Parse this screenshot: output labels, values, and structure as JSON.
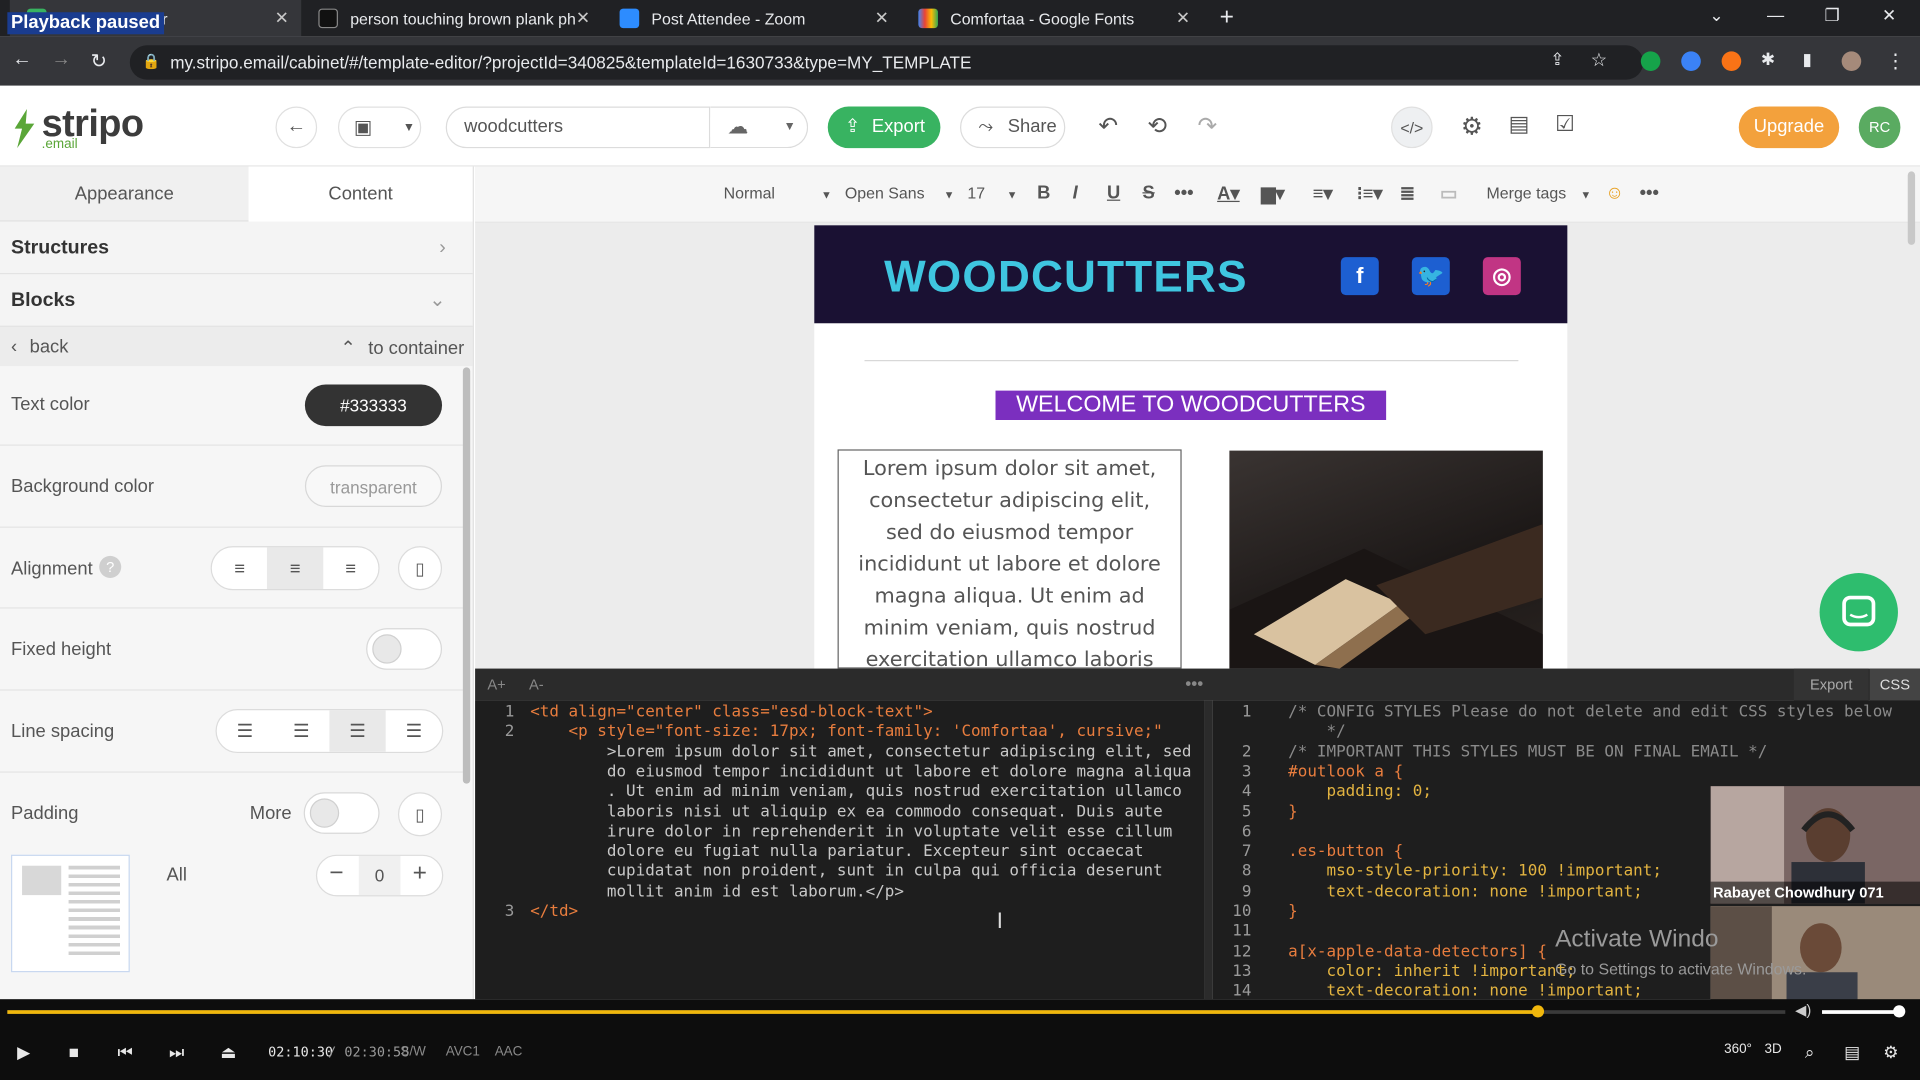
{
  "overlay": {
    "playback_status": "Playback paused"
  },
  "browser": {
    "tabs": [
      {
        "title": "Template editor",
        "active": true,
        "icon": "stripo-favicon"
      },
      {
        "title": "person touching brown plank ph",
        "active": false,
        "icon": "unsplash-favicon"
      },
      {
        "title": "Post Attendee - Zoom",
        "active": false,
        "icon": "zoom-favicon"
      },
      {
        "title": "Comfortaa - Google Fonts",
        "active": false,
        "icon": "google-fonts-favicon"
      }
    ],
    "url": "my.stripo.email/cabinet/#/template-editor/?projectId=340825&templateId=1630733&type=MY_TEMPLATE"
  },
  "app": {
    "logo_word": "stripo",
    "logo_sub": ".email",
    "template_name": "woodcutters",
    "export_label": "Export",
    "share_label": "Share",
    "upgrade_label": "Upgrade",
    "avatar_initials": "RC",
    "brand_color": "#38b361",
    "upgrade_color": "#f3a13c"
  },
  "left_panel": {
    "tabs": [
      "Appearance",
      "Content"
    ],
    "active_tab": "Content",
    "structures_label": "Structures",
    "blocks_label": "Blocks",
    "back_label": "back",
    "to_container_label": "to container",
    "text_color_label": "Text color",
    "text_color_value": "#333333",
    "bg_color_label": "Background color",
    "bg_color_value": "transparent",
    "alignment_label": "Alignment",
    "alignment_selected": "center",
    "fixed_height_label": "Fixed height",
    "line_spacing_label": "Line spacing",
    "padding_label": "Padding",
    "more_label": "More",
    "all_label": "All",
    "padding_value": "0"
  },
  "format_toolbar": {
    "style": "Normal",
    "font": "Open Sans",
    "size": "17",
    "merge_tags": "Merge tags"
  },
  "email": {
    "brand": "WOODCUTTERS",
    "welcome": "WELCOME TO WOODCUTTERS",
    "welcome_bg": "#7b2fbf",
    "header_bg": "#1a1133",
    "brand_color": "#3fc6e0",
    "lorem_lines": [
      "Lorem ipsum dolor sit amet,",
      "consectetur adipiscing elit,",
      "sed do eiusmod tempor",
      "incididunt ut labore et dolore",
      "magna aliqua. Ut enim ad",
      "minim veniam, quis nostrud",
      "exercitation ullamco laboris"
    ],
    "social_icons": [
      "facebook-icon",
      "twitter-icon",
      "instagram-icon"
    ]
  },
  "code_editor": {
    "font_up": "A+",
    "font_down": "A-",
    "export_label": "Export",
    "css_label": "CSS",
    "html_lines": [
      {
        "n": "1",
        "t": "<td align=\"center\" class=\"esd-block-text\">"
      },
      {
        "n": "2",
        "t": "    <p style=\"font-size: 17px; font-family: 'Comfortaa', cursive;\""
      },
      {
        "n": "",
        "t": "        >Lorem ipsum dolor sit amet, consectetur adipiscing elit, sed"
      },
      {
        "n": "",
        "t": "        do eiusmod tempor incididunt ut labore et dolore magna aliqua"
      },
      {
        "n": "",
        "t": "        . Ut enim ad minim veniam, quis nostrud exercitation ullamco"
      },
      {
        "n": "",
        "t": "        laboris nisi ut aliquip ex ea commodo consequat. Duis aute"
      },
      {
        "n": "",
        "t": "        irure dolor in reprehenderit in voluptate velit esse cillum"
      },
      {
        "n": "",
        "t": "        dolore eu fugiat nulla pariatur. Excepteur sint occaecat"
      },
      {
        "n": "",
        "t": "        cupidatat non proident, sunt in culpa qui officia deserunt"
      },
      {
        "n": "",
        "t": "        mollit anim id est laborum.</p>"
      },
      {
        "n": "3",
        "t": "</td>"
      }
    ],
    "css_lines": [
      {
        "n": "1",
        "t": "/* CONFIG STYLES Please do not delete and edit CSS styles below"
      },
      {
        "n": "",
        "t": "    */"
      },
      {
        "n": "2",
        "t": "/* IMPORTANT THIS STYLES MUST BE ON FINAL EMAIL */"
      },
      {
        "n": "3",
        "t": "#outlook a {"
      },
      {
        "n": "4",
        "t": "    padding: 0;"
      },
      {
        "n": "5",
        "t": "}"
      },
      {
        "n": "6",
        "t": ""
      },
      {
        "n": "7",
        "t": ".es-button {"
      },
      {
        "n": "8",
        "t": "    mso-style-priority: 100 !important;"
      },
      {
        "n": "9",
        "t": "    text-decoration: none !important;"
      },
      {
        "n": "10",
        "t": "}"
      },
      {
        "n": "11",
        "t": ""
      },
      {
        "n": "12",
        "t": "a[x-apple-data-detectors] {"
      },
      {
        "n": "13",
        "t": "    color: inherit !important;"
      },
      {
        "n": "14",
        "t": "    text-decoration: none !important;"
      }
    ]
  },
  "video_call": {
    "participant_name": "Rabayet Chowdhury 071"
  },
  "watermark": {
    "title": "Activate Windo",
    "subtitle": "Go to Settings to activate Windows."
  },
  "player": {
    "current_time": "02:10:30",
    "total_time": "/ 02:30:58",
    "progress_fraction": 0.8606,
    "volume_fraction": 1.0,
    "tags": [
      "S/W",
      "AVC1",
      "AAC"
    ],
    "accent": "#f0b70c"
  }
}
